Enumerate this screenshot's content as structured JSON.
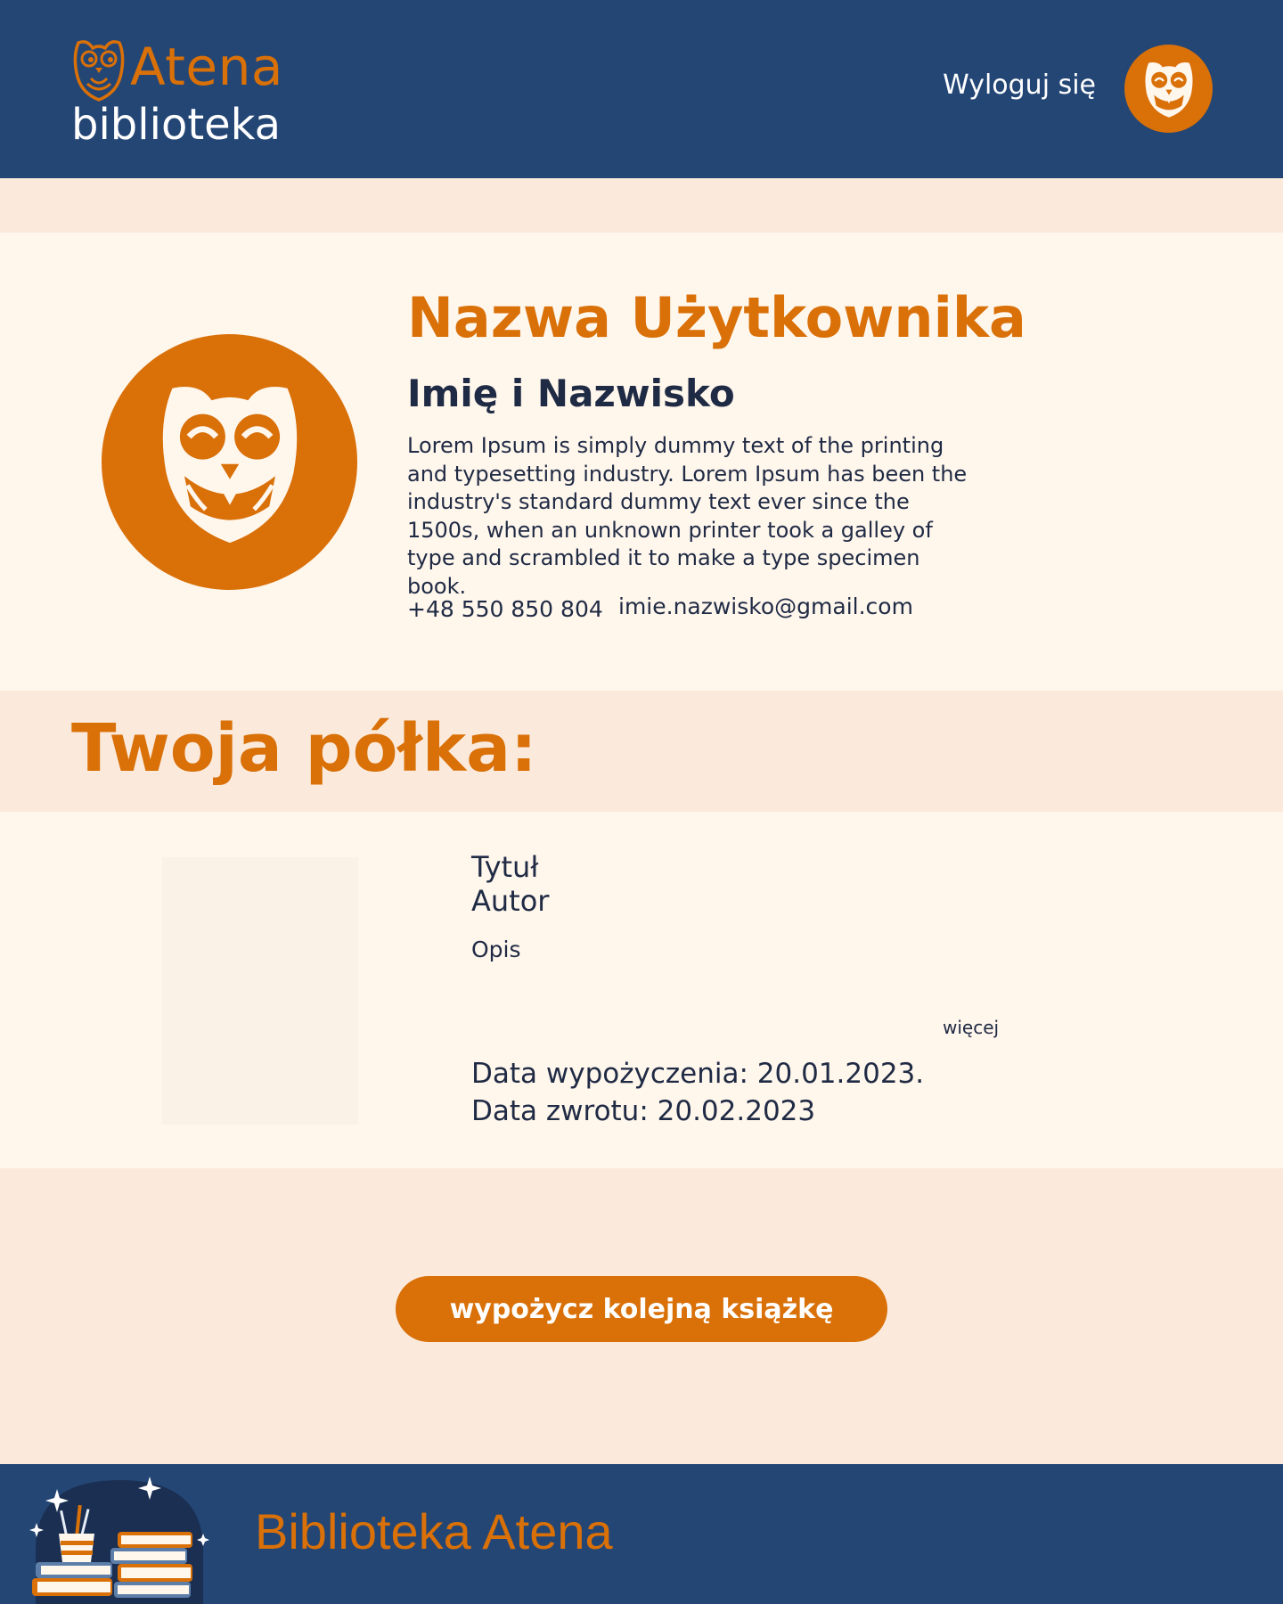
{
  "brand": {
    "title": "Atena",
    "subtitle": "biblioteka"
  },
  "header": {
    "logout_label": "Wyloguj się"
  },
  "profile": {
    "username": "Nazwa Użytkownika",
    "full_name": "Imię i Nazwisko",
    "bio": "Lorem Ipsum is simply dummy text of the printing and typesetting industry. Lorem Ipsum has been the industry's standard dummy text ever since the 1500s, when an unknown printer took a galley of type and scrambled it to make a type specimen book.",
    "phone": "+48 550 850 804",
    "email": "imie.nazwisko@gmail.com"
  },
  "shelf": {
    "title": "Twoja półka:",
    "book": {
      "title": "Tytuł",
      "author": "Autor",
      "description": "Opis",
      "more_label": "więcej",
      "loan_date": "Data wypożyczenia:  20.01.2023.",
      "return_date": "Data zwrotu: 20.02.2023"
    }
  },
  "cta": {
    "label": "wypożycz kolejną książkę"
  },
  "footer": {
    "text": "Biblioteka Atena"
  },
  "icons": {
    "logo": "owl-icon",
    "avatar": "owl-icon",
    "footer": "books-illustration"
  },
  "colors": {
    "navy": "#244675",
    "orange": "#d97008",
    "cream": "#fff6ec",
    "peach": "#fbeadb",
    "text": "#1f2a44"
  }
}
